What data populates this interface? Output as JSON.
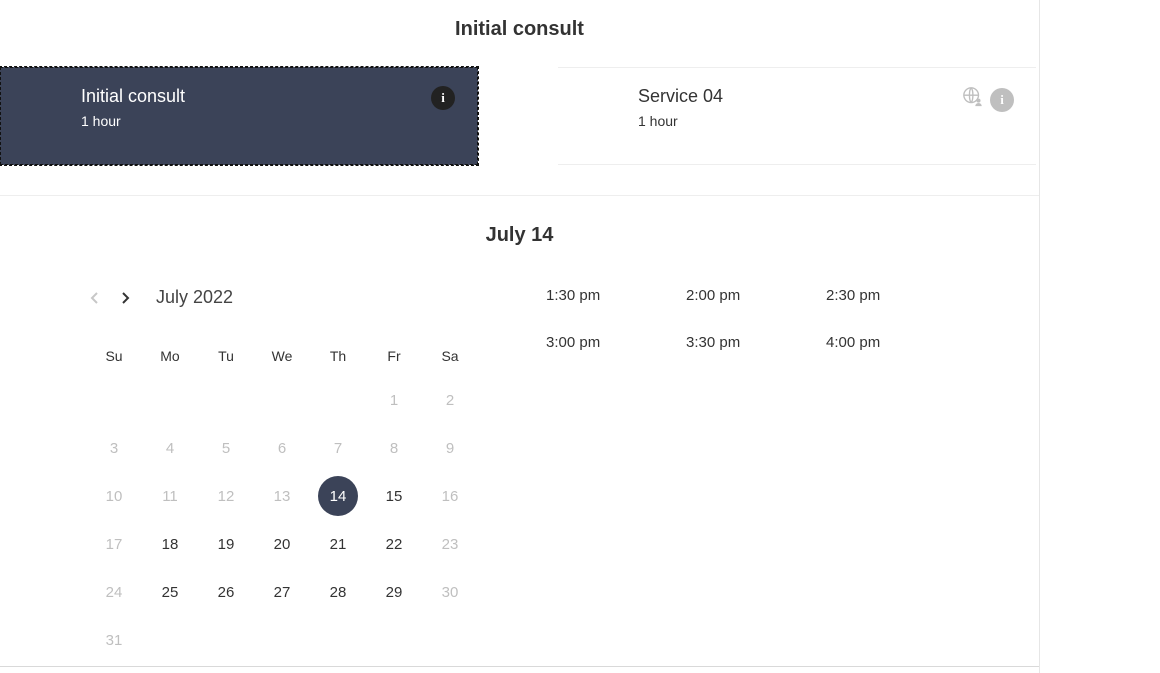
{
  "page_title": "Initial consult",
  "services": [
    {
      "name": "Initial consult",
      "duration": "1 hour",
      "selected": true,
      "icons": [
        "info-dark"
      ]
    },
    {
      "name": "Service 04",
      "duration": "1 hour",
      "selected": false,
      "icons": [
        "globe-person",
        "info-light"
      ]
    }
  ],
  "selected_date_label": "July 14",
  "calendar": {
    "month_label": "July 2022",
    "prev_enabled": false,
    "next_enabled": true,
    "weekdays": [
      "Su",
      "Mo",
      "Tu",
      "We",
      "Th",
      "Fr",
      "Sa"
    ],
    "weeks": [
      [
        {
          "n": "",
          "s": "blank"
        },
        {
          "n": "",
          "s": "blank"
        },
        {
          "n": "",
          "s": "blank"
        },
        {
          "n": "",
          "s": "blank"
        },
        {
          "n": "",
          "s": "blank"
        },
        {
          "n": "1",
          "s": "dim"
        },
        {
          "n": "2",
          "s": "dim"
        }
      ],
      [
        {
          "n": "3",
          "s": "dim"
        },
        {
          "n": "4",
          "s": "dim"
        },
        {
          "n": "5",
          "s": "dim"
        },
        {
          "n": "6",
          "s": "dim"
        },
        {
          "n": "7",
          "s": "dim"
        },
        {
          "n": "8",
          "s": "dim"
        },
        {
          "n": "9",
          "s": "dim"
        }
      ],
      [
        {
          "n": "10",
          "s": "dim"
        },
        {
          "n": "11",
          "s": "dim"
        },
        {
          "n": "12",
          "s": "dim"
        },
        {
          "n": "13",
          "s": "dim"
        },
        {
          "n": "14",
          "s": "selected"
        },
        {
          "n": "15",
          "s": "avail"
        },
        {
          "n": "16",
          "s": "dim"
        }
      ],
      [
        {
          "n": "17",
          "s": "dim"
        },
        {
          "n": "18",
          "s": "avail"
        },
        {
          "n": "19",
          "s": "avail"
        },
        {
          "n": "20",
          "s": "avail"
        },
        {
          "n": "21",
          "s": "avail"
        },
        {
          "n": "22",
          "s": "avail"
        },
        {
          "n": "23",
          "s": "dim"
        }
      ],
      [
        {
          "n": "24",
          "s": "dim"
        },
        {
          "n": "25",
          "s": "avail"
        },
        {
          "n": "26",
          "s": "avail"
        },
        {
          "n": "27",
          "s": "avail"
        },
        {
          "n": "28",
          "s": "avail"
        },
        {
          "n": "29",
          "s": "avail"
        },
        {
          "n": "30",
          "s": "dim"
        }
      ],
      [
        {
          "n": "31",
          "s": "dim"
        },
        {
          "n": "",
          "s": "blank"
        },
        {
          "n": "",
          "s": "blank"
        },
        {
          "n": "",
          "s": "blank"
        },
        {
          "n": "",
          "s": "blank"
        },
        {
          "n": "",
          "s": "blank"
        },
        {
          "n": "",
          "s": "blank"
        }
      ]
    ]
  },
  "time_slots": [
    "1:30 pm",
    "2:00 pm",
    "2:30 pm",
    "3:00 pm",
    "3:30 pm",
    "4:00 pm"
  ]
}
